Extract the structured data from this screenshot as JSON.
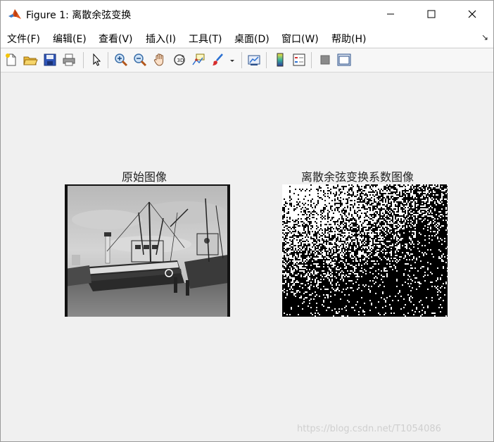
{
  "window": {
    "title": "Figure 1: 离散余弦变换"
  },
  "menu": [
    {
      "label": "文件(F)"
    },
    {
      "label": "编辑(E)"
    },
    {
      "label": "查看(V)"
    },
    {
      "label": "插入(I)"
    },
    {
      "label": "工具(T)"
    },
    {
      "label": "桌面(D)"
    },
    {
      "label": "窗口(W)"
    },
    {
      "label": "帮助(H)"
    }
  ],
  "menu_dock_arrow": "↘",
  "toolbar": {
    "icons": [
      "new-figure-icon",
      "open-file-icon",
      "save-icon",
      "print-icon",
      "pointer-icon",
      "zoom-in-icon",
      "zoom-out-icon",
      "pan-hand-icon",
      "rotate-3d-icon",
      "data-cursor-icon",
      "brush-icon",
      "brush-dropdown-icon",
      "link-plot-icon",
      "colorbar-icon",
      "legend-icon",
      "hide-plot-tools-icon",
      "show-plot-tools-icon"
    ]
  },
  "axes": [
    {
      "title": "原始图像"
    },
    {
      "title": "离散余弦变换系数图像"
    }
  ],
  "watermark": "https://blog.csdn.net/T1054086"
}
